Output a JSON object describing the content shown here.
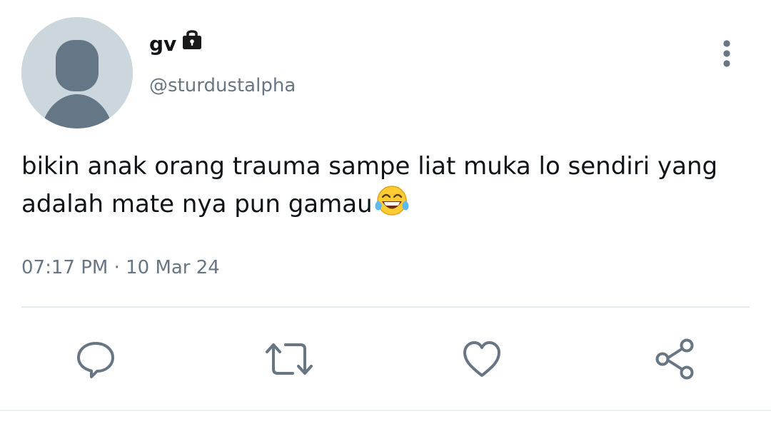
{
  "tweet": {
    "display_name": "gv",
    "handle": "@sturdustalpha",
    "text": "bikin anak orang trauma sampe liat muka lo sendiri yang\nadalah mate nya pun gamau",
    "timestamp": "07:17 PM · 10 Mar 24"
  },
  "icons": {
    "avatar": "default-avatar",
    "protected": "lock-icon",
    "more": "vertical-ellipsis-icon",
    "emoji": "face-with-tears-of-joy",
    "reply": "comment-bubble-icon",
    "retweet": "retweet-arrows-icon",
    "like": "heart-icon",
    "share": "share-icon"
  },
  "colors": {
    "text_primary": "#0f1419",
    "text_secondary": "#687684",
    "icon_gray": "#687684",
    "avatar_bg": "#ccd6dd",
    "avatar_figure": "#657786",
    "divider": "#e6ecf0"
  }
}
